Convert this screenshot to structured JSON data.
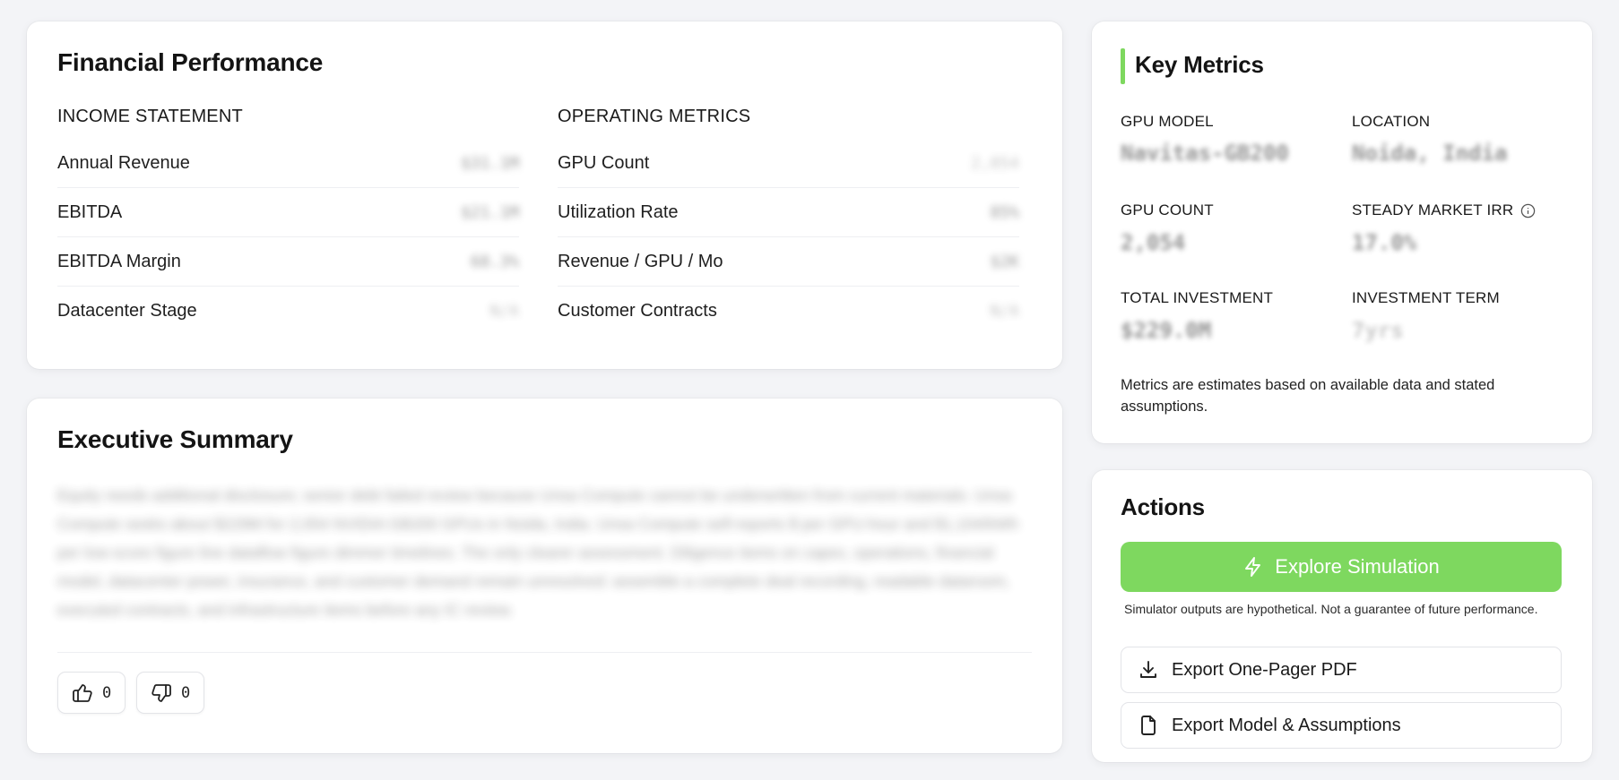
{
  "financial": {
    "title": "Financial Performance",
    "income_heading": "INCOME STATEMENT",
    "operating_heading": "OPERATING METRICS",
    "income_rows": [
      {
        "label": "Annual Revenue",
        "value": "$31.1M"
      },
      {
        "label": "EBITDA",
        "value": "$21.1M"
      },
      {
        "label": "EBITDA Margin",
        "value": "68.3%"
      },
      {
        "label": "Datacenter Stage",
        "value": "N/A"
      }
    ],
    "operating_rows": [
      {
        "label": "GPU Count",
        "value": "2,054"
      },
      {
        "label": "Utilization Rate",
        "value": "85%"
      },
      {
        "label": "Revenue / GPU / Mo",
        "value": "$2K"
      },
      {
        "label": "Customer Contracts",
        "value": "N/A"
      }
    ]
  },
  "executive": {
    "title": "Executive Summary",
    "summary": "Equity needs additional disclosure; senior debt failed review because Unsa Compute cannot be underwritten from current materials. Unsa Compute seeks about $229M for 2,054 NVIDIA GB200 GPUs in Noida, India. Unsa Compute self-reports $ per GPU-hour and $1,104/kWh per low-score figure line dataflow figure dimmer timelines. The only clearer assessment. Diligence items on capex, operations, financial model, datacenter power, insurance, and customer demand remain unresolved: assemble a complete deal recording, readable dataroom, executed contracts, and infrastructure items before any IC review.",
    "likes": "0",
    "dislikes": "0"
  },
  "metrics": {
    "title": "Key Metrics",
    "items": [
      {
        "label": "GPU MODEL",
        "value": "Navitas-GB200"
      },
      {
        "label": "LOCATION",
        "value": "Noida, India"
      },
      {
        "label": "GPU COUNT",
        "value": "2,054"
      },
      {
        "label": "STEADY MARKET IRR",
        "value": "17.0%"
      },
      {
        "label": "TOTAL INVESTMENT",
        "value": "$229.0M"
      },
      {
        "label": "INVESTMENT TERM",
        "value": "7yrs"
      }
    ],
    "note": "Metrics are estimates based on available data and stated assumptions."
  },
  "actions": {
    "title": "Actions",
    "simulate_label": "Explore Simulation",
    "disclaimer": "Simulator outputs are hypothetical. Not a guarantee of future performance.",
    "export_pdf_label": "Export One-Pager PDF",
    "export_model_label": "Export Model & Assumptions"
  },
  "icons": {
    "thumbs_up": "thumbs-up-icon",
    "thumbs_down": "thumbs-down-icon",
    "info": "info-icon",
    "lightning": "lightning-icon",
    "download": "download-icon",
    "file": "file-icon"
  },
  "colors": {
    "accent": "#7ed85f",
    "background": "#f3f4f7",
    "card": "#ffffff"
  }
}
